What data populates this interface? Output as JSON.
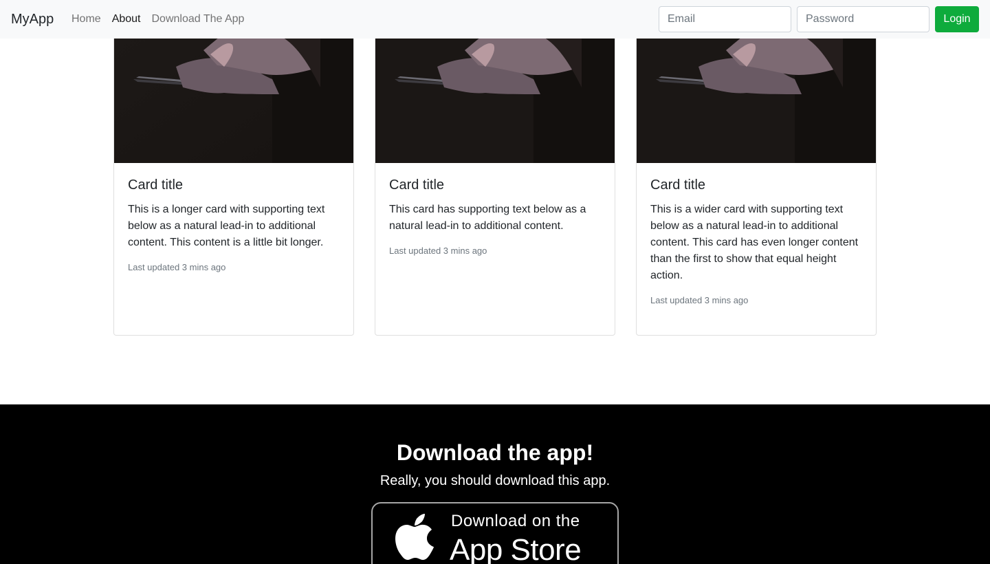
{
  "navbar": {
    "brand": "MyApp",
    "links": [
      {
        "label": "Home",
        "active": false
      },
      {
        "label": "About",
        "active": true
      },
      {
        "label": "Download The App",
        "active": false
      }
    ],
    "email_placeholder": "Email",
    "password_placeholder": "Password",
    "login_label": "Login",
    "login_color": "#0eab3c"
  },
  "cards": [
    {
      "title": "Card title",
      "text": "This is a longer card with supporting text below as a natural lead-in to additional content. This content is a little bit longer.",
      "updated": "Last updated 3 mins ago",
      "image": "hands-holding-phone-photo"
    },
    {
      "title": "Card title",
      "text": "This card has supporting text below as a natural lead-in to additional content.",
      "updated": "Last updated 3 mins ago",
      "image": "hands-holding-phone-photo"
    },
    {
      "title": "Card title",
      "text": "This is a wider card with supporting text below as a natural lead-in to additional content. This card has even longer content than the first to show that equal height action.",
      "updated": "Last updated 3 mins ago",
      "image": "hands-holding-phone-photo"
    }
  ],
  "download": {
    "title": "Download the app!",
    "subtitle": "Really, you should download this app.",
    "badge_line1": "Download on the",
    "badge_line2": "App Store",
    "badge_icon": "apple-icon"
  }
}
